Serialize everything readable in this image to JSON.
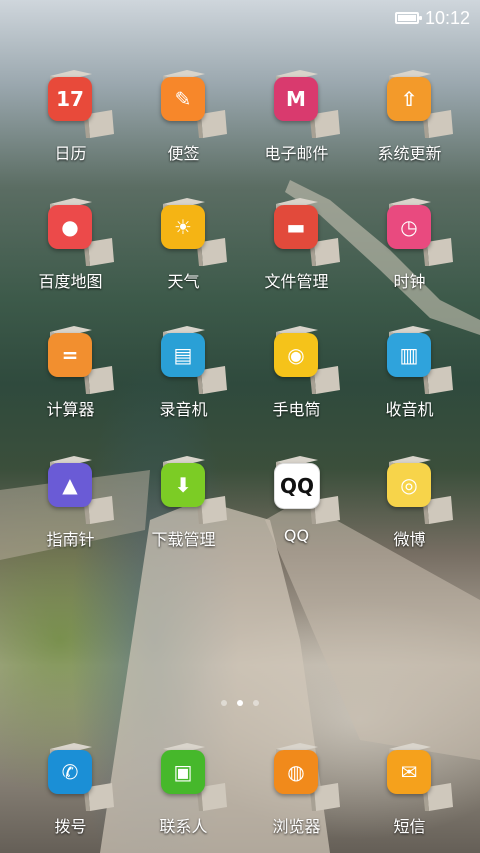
{
  "status_bar": {
    "time": "10:12"
  },
  "page_indicator": {
    "count": 3,
    "active": 1
  },
  "grid_apps": [
    {
      "label": "日历",
      "icon": "calendar-icon",
      "color": "#e84a3a",
      "glyph": "17"
    },
    {
      "label": "便签",
      "icon": "notes-icon",
      "color": "#f7872a",
      "glyph": "✎"
    },
    {
      "label": "电子邮件",
      "icon": "email-icon",
      "color": "#d93a6e",
      "glyph": "M"
    },
    {
      "label": "系统更新",
      "icon": "update-icon",
      "color": "#f39a2a",
      "glyph": "⇧"
    },
    {
      "label": "百度地图",
      "icon": "map-icon",
      "color": "#ec4a4a",
      "glyph": "●"
    },
    {
      "label": "天气",
      "icon": "weather-icon",
      "color": "#f5b414",
      "glyph": "☀"
    },
    {
      "label": "文件管理",
      "icon": "folder-icon",
      "color": "#e24a3b",
      "glyph": "▬"
    },
    {
      "label": "时钟",
      "icon": "clock-icon",
      "color": "#e94a7f",
      "glyph": "◷"
    },
    {
      "label": "计算器",
      "icon": "calculator-icon",
      "color": "#f28f2f",
      "glyph": "="
    },
    {
      "label": "录音机",
      "icon": "recorder-icon",
      "color": "#2aa0d6",
      "glyph": "▤"
    },
    {
      "label": "手电筒",
      "icon": "flashlight-icon",
      "color": "#f5c31a",
      "glyph": "◉"
    },
    {
      "label": "收音机",
      "icon": "radio-icon",
      "color": "#2fa3dc",
      "glyph": "▥"
    },
    {
      "label": "指南针",
      "icon": "compass-icon",
      "color": "#6a5bd6",
      "glyph": "▲"
    },
    {
      "label": "下载管理",
      "icon": "download-icon",
      "color": "#7ccc25",
      "glyph": "⬇"
    },
    {
      "label": "QQ",
      "icon": "qq-icon",
      "color": "#ffffff",
      "glyph": "QQ"
    },
    {
      "label": "微博",
      "icon": "weibo-icon",
      "color": "#f7d44a",
      "glyph": "◎"
    }
  ],
  "dock_apps": [
    {
      "label": "拨号",
      "icon": "phone-icon",
      "color": "#1b8fd6",
      "glyph": "✆"
    },
    {
      "label": "联系人",
      "icon": "contacts-icon",
      "color": "#46b82b",
      "glyph": "▣"
    },
    {
      "label": "浏览器",
      "icon": "browser-icon",
      "color": "#f18a1b",
      "glyph": "◍"
    },
    {
      "label": "短信",
      "icon": "sms-icon",
      "color": "#f5a11c",
      "glyph": "✉"
    }
  ]
}
